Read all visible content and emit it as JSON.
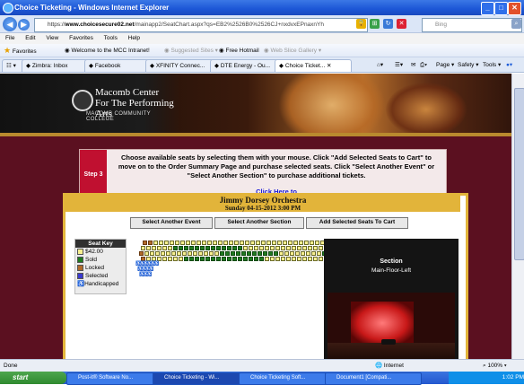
{
  "window": {
    "title": "Choice Ticketing - Windows Internet Explorer"
  },
  "address": {
    "scheme": "https://",
    "host": "www.choicesecure02.net",
    "path": "/mainapp2/SeatChart.aspx?qs=EB2%2526B0%2526CJ+nxdvxEPnaxnYh"
  },
  "search": {
    "placeholder": "Bing"
  },
  "menu": [
    "File",
    "Edit",
    "View",
    "Favorites",
    "Tools",
    "Help"
  ],
  "favorites": {
    "label": "Favorites",
    "items": [
      "Welcome to the MCC Intranet!",
      "Suggested Sites ▾",
      "Free Hotmail",
      "Web Slice Gallery ▾"
    ]
  },
  "tabs": [
    "Zimbra: Inbox",
    "Facebook",
    "XFINITY Connec...",
    "DTE Energy - Ou...",
    "Choice Ticket..."
  ],
  "toolbar": [
    "Page ▾",
    "Safety ▾",
    "Tools ▾"
  ],
  "logo": {
    "line1": "Macomb Center",
    "line2": "For The Performing Arts",
    "sub": "MACOMB COMMUNITY COLLEGE"
  },
  "step": {
    "label": "Step 3",
    "text": "Choose available seats by selecting them with your mouse. Click \"Add Selected Seats to Cart\" to move on to the Order Summary Page and purchase selected seats. Click \"Select Another Event\" or \"Select Another Section\" to purchase additional tickets.",
    "link": "Click Here to"
  },
  "event": {
    "name": "Jimmy Dorsey Orchestra",
    "date": "Sunday 04-15-2012 3:00 PM"
  },
  "buttons": {
    "another_event": "Select Another Event",
    "another_section": "Select Another Section",
    "add_to_cart": "Add Selected Seats To Cart"
  },
  "seat_key": {
    "title": "Seat Key",
    "items": [
      "$42.00",
      "Sold",
      "Locked",
      "Selected",
      "Handicapped"
    ]
  },
  "section": {
    "title": "Section",
    "name": "Main-Floor-Left"
  },
  "status": {
    "left": "Done",
    "zone": "Internet",
    "zoom": "100%"
  },
  "taskbar": {
    "start": "start",
    "items": [
      "Post-it® Software No...",
      "Choice Ticketing - Wi...",
      "Choice Ticketing Soft...",
      "Document1 [Compati..."
    ],
    "clock": "1:02 PM"
  }
}
